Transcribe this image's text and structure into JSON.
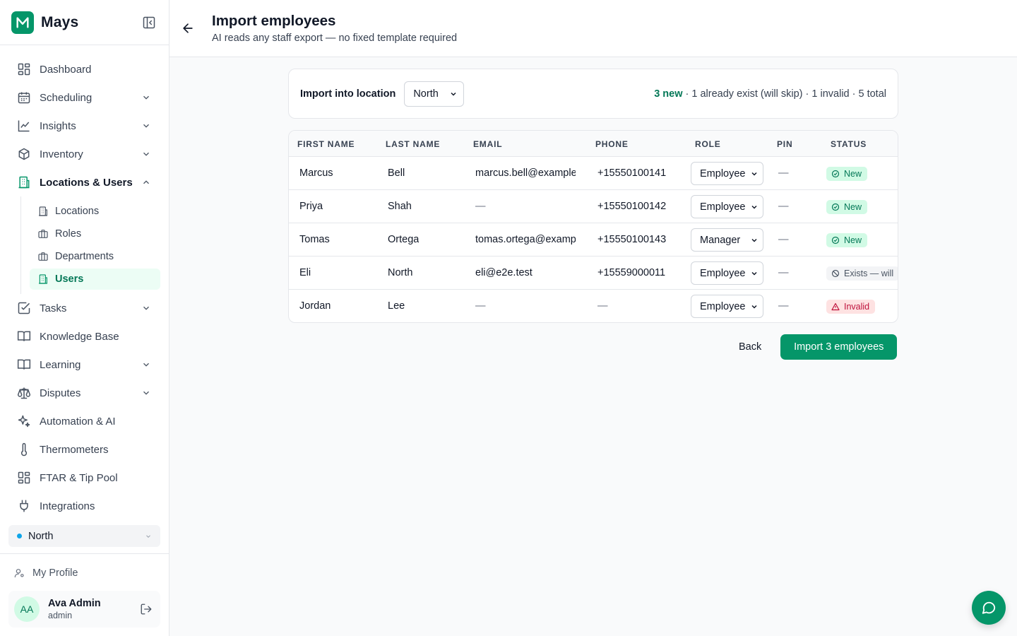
{
  "brand": {
    "name": "Mays"
  },
  "sidebar": {
    "items": [
      {
        "label": "Dashboard",
        "icon": "dashboard-icon",
        "has_children": false
      },
      {
        "label": "Scheduling",
        "icon": "calendar-icon",
        "has_children": true
      },
      {
        "label": "Insights",
        "icon": "chart-line-icon",
        "has_children": true
      },
      {
        "label": "Inventory",
        "icon": "box-icon",
        "has_children": true
      },
      {
        "label": "Locations & Users",
        "icon": "building-icon",
        "has_children": true,
        "expanded": true
      },
      {
        "label": "Tasks",
        "icon": "checkbox-icon",
        "has_children": true
      },
      {
        "label": "Knowledge Base",
        "icon": "book-icon",
        "has_children": false
      },
      {
        "label": "Learning",
        "icon": "book-open-icon",
        "has_children": true
      },
      {
        "label": "Disputes",
        "icon": "scale-icon",
        "has_children": true
      },
      {
        "label": "Automation & AI",
        "icon": "sparkles-icon",
        "has_children": false
      },
      {
        "label": "Thermometers",
        "icon": "thermometer-icon",
        "has_children": false
      },
      {
        "label": "FTAR & Tip Pool",
        "icon": "grid-icon",
        "has_children": false
      },
      {
        "label": "Integrations",
        "icon": "plug-icon",
        "has_children": false
      }
    ],
    "sub_items": [
      {
        "label": "Locations",
        "icon": "building-icon"
      },
      {
        "label": "Roles",
        "icon": "briefcase-icon"
      },
      {
        "label": "Departments",
        "icon": "briefcase-icon"
      },
      {
        "label": "Users",
        "icon": "building-icon",
        "active": true
      }
    ],
    "location_switcher": {
      "value": "North",
      "dot_color": "#0ea5e9"
    },
    "profile_link": "My Profile",
    "user": {
      "initials": "AA",
      "name": "Ava Admin",
      "role": "admin"
    }
  },
  "header": {
    "title": "Import employees",
    "subtitle": "AI reads any staff export — no fixed template required"
  },
  "import_location": {
    "label": "Import into location",
    "value": "North",
    "summary_new": "3 new",
    "summary_rest": " · 1 already exist (will skip) · 1 invalid · 5 total"
  },
  "table": {
    "columns": [
      "FIRST NAME",
      "LAST NAME",
      "EMAIL",
      "PHONE",
      "ROLE",
      "PIN",
      "STATUS"
    ],
    "rows": [
      {
        "first": "Marcus",
        "last": "Bell",
        "email": "marcus.bell@example",
        "phone": "+15550100141",
        "role": "Employee",
        "pin": "—",
        "status": "New",
        "status_type": "new"
      },
      {
        "first": "Priya",
        "last": "Shah",
        "email": "—",
        "phone": "+15550100142",
        "role": "Employee",
        "pin": "—",
        "status": "New",
        "status_type": "new"
      },
      {
        "first": "Tomas",
        "last": "Ortega",
        "email": "tomas.ortega@examp",
        "phone": "+15550100143",
        "role": "Manager",
        "pin": "—",
        "status": "New",
        "status_type": "new"
      },
      {
        "first": "Eli",
        "last": "North",
        "email": "eli@e2e.test",
        "phone": "+15559000011",
        "role": "Employee",
        "pin": "—",
        "status": "Exists — will",
        "status_type": "exists"
      },
      {
        "first": "Jordan",
        "last": "Lee",
        "email": "—",
        "phone": "—",
        "role": "Employee",
        "pin": "—",
        "status": "Invalid",
        "status_type": "invalid"
      }
    ]
  },
  "actions": {
    "back": "Back",
    "import": "Import 3 employees"
  },
  "colors": {
    "accent": "#059669",
    "new_text": "#047857",
    "invalid_text": "#be123c"
  }
}
